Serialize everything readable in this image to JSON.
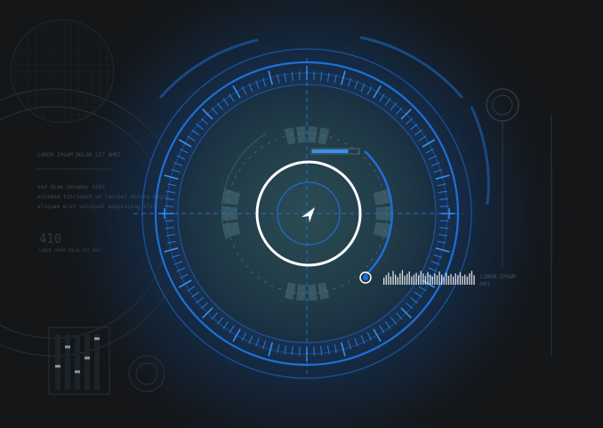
{
  "left_panel": {
    "heading": "LOREM IPSUM DOLOR SIT AMET",
    "paragraph_lines": [
      "sed diam nonummy nibh",
      "euismod tincidunt ut laoreet dolore magna",
      "aliquam erat volutpat adipiscing elit"
    ],
    "big_readout": "410",
    "sub_readout": "LOREM IPSUM DOLOR SIT AMET",
    "level_bars": [
      0.45,
      0.8,
      0.35,
      0.6,
      0.95
    ]
  },
  "hud": {
    "progress": 0.78,
    "waveform": [
      0.35,
      0.55,
      0.75,
      0.45,
      0.9,
      0.6,
      0.4,
      0.7,
      0.95,
      0.5,
      0.65,
      0.85,
      0.45,
      0.6,
      0.75,
      0.55,
      0.9,
      0.7,
      0.5,
      0.8,
      0.6,
      0.45,
      0.7,
      0.55,
      0.85,
      0.6,
      0.4,
      0.75,
      0.5,
      0.65,
      0.45,
      0.7,
      0.55,
      0.8,
      0.5,
      0.6,
      0.45,
      0.7,
      0.9,
      0.55
    ],
    "wave_label_1": "LOREM IPSUM",
    "wave_label_2": "001"
  },
  "colors": {
    "background": "#141618",
    "accent_blue": "#1f6fd8",
    "glow": "#1e5fa8",
    "teal_center": "#2b4a4e",
    "white": "#ffffff"
  },
  "icons": {
    "center": "navigation-arrow-icon",
    "target": "target-dot-icon"
  }
}
